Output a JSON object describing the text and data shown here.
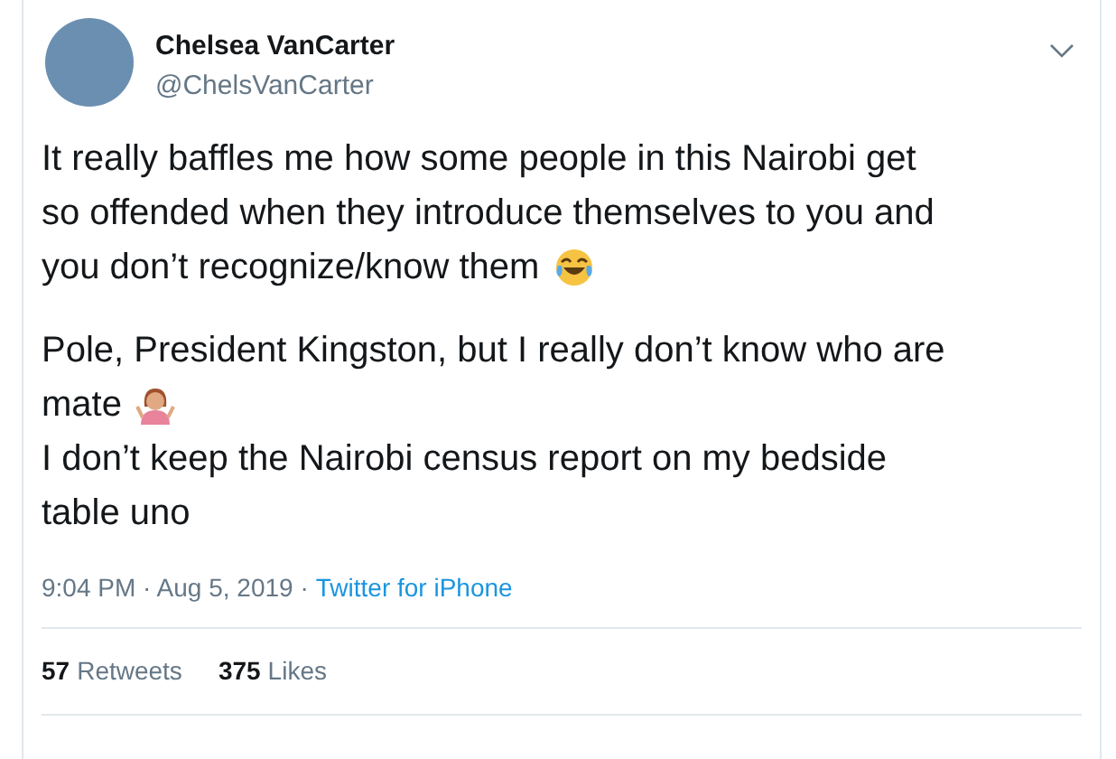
{
  "author": {
    "name": "Chelsea VanCarter",
    "handle": "@ChelsVanCarter"
  },
  "paragraphs": [
    {
      "lines": [
        {
          "text": "It really baffles me how some people in this Nairobi get",
          "kind": "plain"
        },
        {
          "text": "so offended when they introduce themselves to you and",
          "kind": "plain"
        },
        {
          "text": "you don’t recognize/know them",
          "kind": "laughing"
        }
      ]
    },
    {
      "lines": [
        {
          "text": "Pole, President Kingston, but I really don’t know who are",
          "kind": "plain"
        },
        {
          "text": "mate",
          "kind": "shrugging"
        },
        {
          "text": "I don’t keep the Nairobi census report on my bedside",
          "kind": "plain"
        },
        {
          "text": "table uno",
          "kind": "plain"
        }
      ]
    }
  ],
  "timestamp": "9:04 PM · Aug 5, 2019 ·",
  "source": "Twitter for iPhone",
  "stats": [
    {
      "count": "57",
      "label": "Retweets"
    },
    {
      "count": "375",
      "label": "Likes"
    }
  ]
}
